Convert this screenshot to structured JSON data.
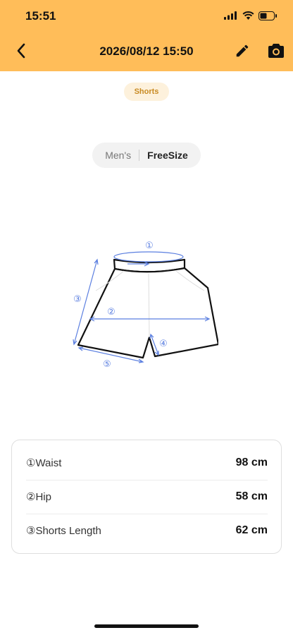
{
  "status_bar": {
    "time": "15:51"
  },
  "header": {
    "title": "2026/08/12 15:50"
  },
  "category": "Shorts",
  "size": {
    "gender": "Men's",
    "name": "FreeSize"
  },
  "diagram": {
    "markers": [
      "①",
      "②",
      "③",
      "④",
      "⑤"
    ]
  },
  "measurements": [
    {
      "label": "①Waist",
      "value": "98 cm"
    },
    {
      "label": "②Hip",
      "value": "58 cm"
    },
    {
      "label": "③Shorts Length",
      "value": "62 cm"
    }
  ],
  "colors": {
    "header": "#ffbd59",
    "chip_text": "#c88a22",
    "diagram_blue": "#5b7fe0"
  }
}
